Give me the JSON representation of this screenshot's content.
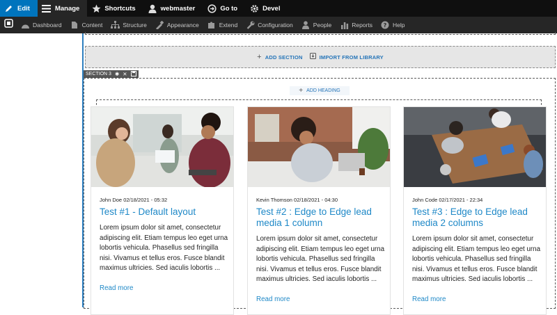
{
  "toolbar": {
    "edit": "Edit",
    "manage": "Manage",
    "shortcuts": "Shortcuts",
    "user": "webmaster",
    "goto": "Go to",
    "devel": "Devel"
  },
  "admin_menu": [
    {
      "label": "Dashboard",
      "icon": "dashboard-icon"
    },
    {
      "label": "Content",
      "icon": "content-icon"
    },
    {
      "label": "Structure",
      "icon": "structure-icon"
    },
    {
      "label": "Appearance",
      "icon": "appearance-icon"
    },
    {
      "label": "Extend",
      "icon": "extend-icon"
    },
    {
      "label": "Configuration",
      "icon": "configuration-icon"
    },
    {
      "label": "People",
      "icon": "people-icon"
    },
    {
      "label": "Reports",
      "icon": "reports-icon"
    },
    {
      "label": "Help",
      "icon": "help-icon"
    }
  ],
  "builder": {
    "add_section": "ADD SECTION",
    "import_library": "IMPORT FROM LIBRARY",
    "section_label": "SECTION 3",
    "add_heading": "ADD HEADING"
  },
  "cards": [
    {
      "meta": "John Doe 02/18/2021 - 05:32",
      "title": "Test #1 - Default layout",
      "body": "Lorem ipsum dolor sit amet, consectetur adipiscing elit. Etiam tempus leo eget urna lobortis vehicula. Phasellus sed fringilla nisi. Vivamus et tellus eros. Fusce blandit maximus ultricies. Sed iaculis lobortis ...",
      "more": "Read more"
    },
    {
      "meta": "Kevin Thomson 02/18/2021 - 04:30",
      "title": "Test #2 : Edge to Edge lead media 1 column",
      "body": "Lorem ipsum dolor sit amet, consectetur adipiscing elit. Etiam tempus leo eget urna lobortis vehicula. Phasellus sed fringilla nisi. Vivamus et tellus eros. Fusce blandit maximus ultricies. Sed iaculis lobortis ...",
      "more": "Read more"
    },
    {
      "meta": "John Code 02/17/2021 - 22:34",
      "title": "Test #3 : Edge to Edge lead media 2 columns",
      "body": "Lorem ipsum dolor sit amet, consectetur adipiscing elit. Etiam tempus leo eget urna lobortis vehicula. Phasellus sed fringilla nisi. Vivamus et tellus eros. Fusce blandit maximus ultricies. Sed iaculis lobortis ...",
      "more": "Read more"
    }
  ],
  "colors": {
    "toolbar_bg": "#0f0f0f",
    "menu_bg": "#262626",
    "accent": "#0074bd",
    "link": "#1e88c7"
  }
}
